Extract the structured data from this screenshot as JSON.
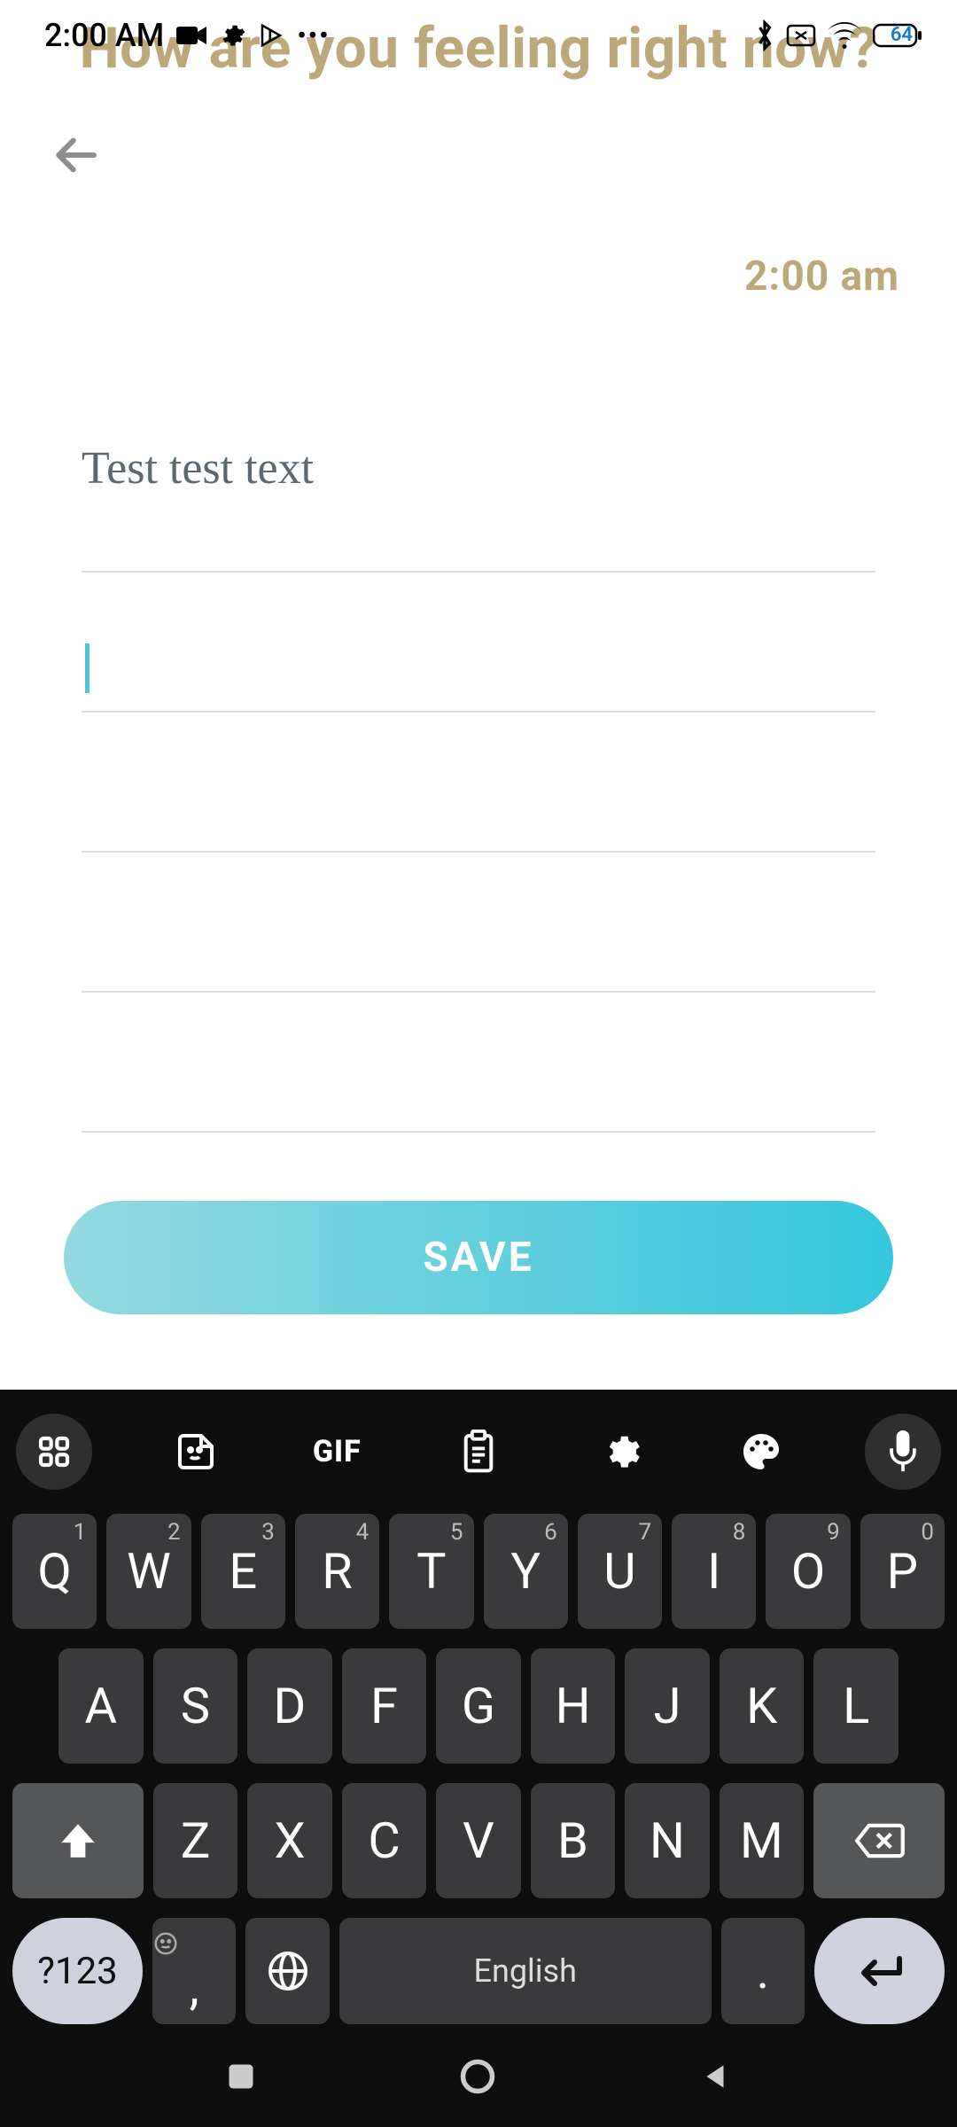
{
  "status": {
    "time": "2:00 AM",
    "battery": "64"
  },
  "header": {
    "title": "How are you feeling right now?",
    "timestamp": "2:00 am"
  },
  "note": {
    "text": "Test test text"
  },
  "actions": {
    "save_label": "SAVE"
  },
  "keyboard": {
    "gif_label": "GIF",
    "row1": [
      {
        "k": "Q",
        "s": "1"
      },
      {
        "k": "W",
        "s": "2"
      },
      {
        "k": "E",
        "s": "3"
      },
      {
        "k": "R",
        "s": "4"
      },
      {
        "k": "T",
        "s": "5"
      },
      {
        "k": "Y",
        "s": "6"
      },
      {
        "k": "U",
        "s": "7"
      },
      {
        "k": "I",
        "s": "8"
      },
      {
        "k": "O",
        "s": "9"
      },
      {
        "k": "P",
        "s": "0"
      }
    ],
    "row2": [
      "A",
      "S",
      "D",
      "F",
      "G",
      "H",
      "J",
      "K",
      "L"
    ],
    "row3": [
      "Z",
      "X",
      "C",
      "V",
      "B",
      "N",
      "M"
    ],
    "sym_label": "?123",
    "comma": ",",
    "space_label": "English",
    "dot": "."
  }
}
